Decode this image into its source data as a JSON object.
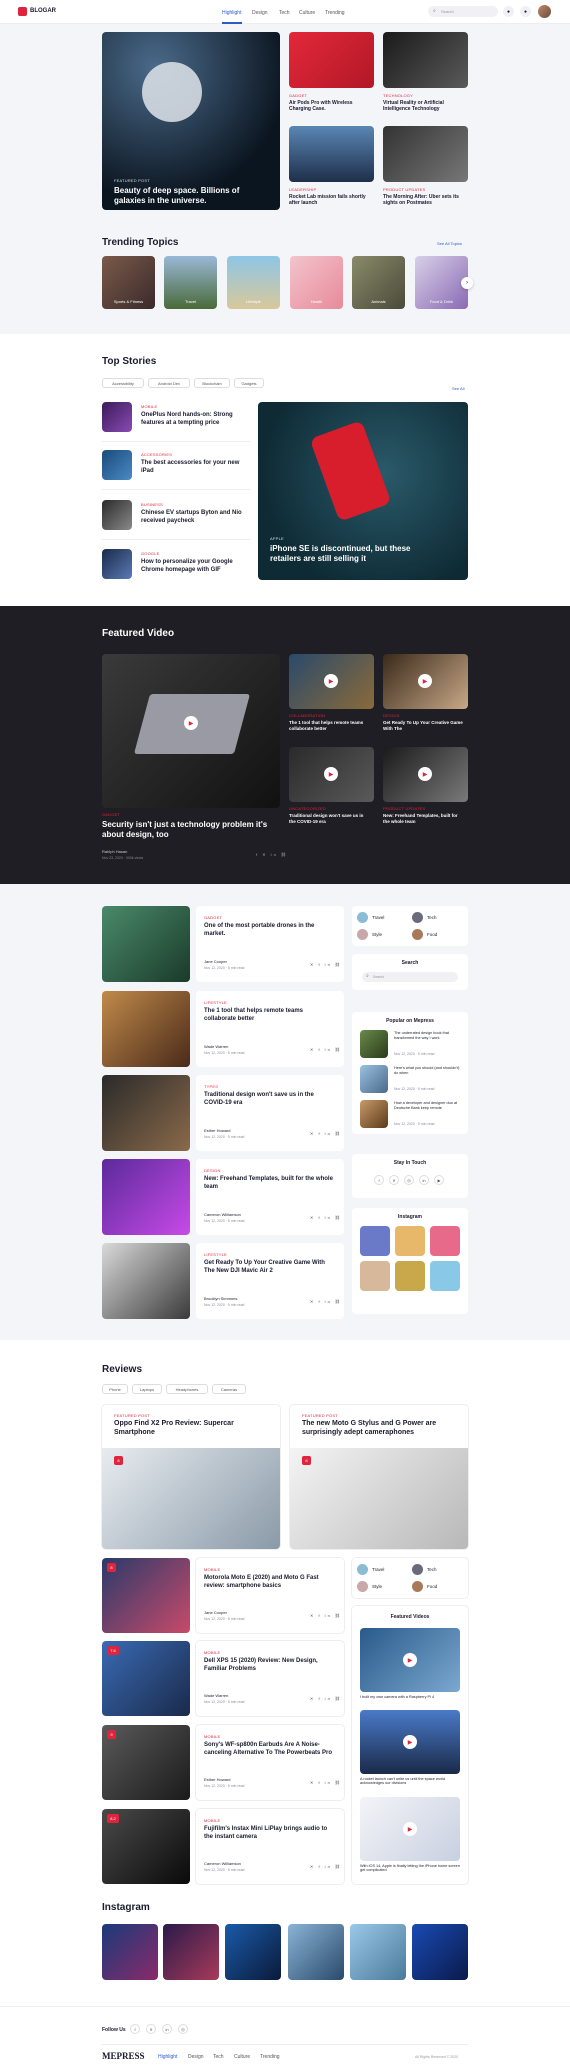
{
  "brand": {
    "name": "BLOGAR",
    "accent": "#e0243d"
  },
  "nav": [
    "Highlight",
    "Design",
    "Tech",
    "Culture",
    "Trending"
  ],
  "search": {
    "placeholder": "Search"
  },
  "hero": {
    "main": {
      "category": "FEATURED POST",
      "title": "Beauty of deep space. Billions of galaxies in the universe."
    },
    "items": [
      {
        "category": "GADGET",
        "title": "Air Pods Pro with Wireless Charging Case."
      },
      {
        "category": "TECHNOLOGY",
        "title": "Virtual Reality or Artificial Intelligence Technology"
      },
      {
        "category": "LEADERSHIP",
        "title": "Rocket Lab mission fails shortly after launch"
      },
      {
        "category": "PRODUCT UPDATES",
        "title": "The Morning After: Uber sets its sights on Postmates"
      }
    ]
  },
  "trending": {
    "title": "Trending Topics",
    "link": "See All Topics",
    "items": [
      "Sports & Fitness",
      "Travel",
      "Lifestyle",
      "Health",
      "Animals",
      "Food & Drink"
    ]
  },
  "top": {
    "title": "Top Stories",
    "link": "See All",
    "tabs": [
      "Accessibility",
      "Android Dev",
      "Blockchain",
      "Gadgets"
    ],
    "list": [
      {
        "category": "MOBILE",
        "title": "OnePlus Nord hands-on: Strong features at a tempting price"
      },
      {
        "category": "ACCESSORIES",
        "title": "The best accessories for your new iPad"
      },
      {
        "category": "BUSINESS",
        "title": "Chinese EV startups Byton and Nio received paycheck"
      },
      {
        "category": "GOOGLE",
        "title": "How to personalize your Google Chrome homepage with GIF"
      }
    ],
    "feature": {
      "category": "APPLE",
      "title": "iPhone SE is discontinued, but these retailers are still selling it"
    }
  },
  "video": {
    "title": "Featured Video",
    "main": {
      "category": "GADGET",
      "title": "Security isn't just a technology problem it's about design, too",
      "author": "Rahlph Hasan",
      "meta": "Nov 23, 2020  ·  300k views"
    },
    "items": [
      {
        "category": "COLLABORATION",
        "title": "The 1 tool that helps remote teams collaborate better"
      },
      {
        "category": "DESIGN",
        "title": "Get Ready To Up Your Creative Game With The"
      },
      {
        "category": "UNCATEGORIZED",
        "title": "Traditional design won't save us in the COVID-19 era"
      },
      {
        "category": "PRODUCT UPDATES",
        "title": "New: Freehand Templates, built for the whole team"
      }
    ]
  },
  "posts": [
    {
      "category": "GADGET",
      "title": "One of the most portable drones in the market.",
      "author": "Jane Cooper",
      "meta": "Nov 12, 2020  ·  5 min read"
    },
    {
      "category": "LIFESTYLE",
      "title": "The 1 tool that helps remote teams collaborate better",
      "author": "Wade Warren",
      "meta": "Nov 12, 2020  ·  5 min read"
    },
    {
      "category": "TYPES",
      "title": "Traditional design won't save us in the COVID-19 era",
      "author": "Esther Howard",
      "meta": "Nov 12, 2020  ·  5 min read"
    },
    {
      "category": "DESIGN",
      "title": "New: Freehand Templates, built for the whole team",
      "author": "Cameron Williamson",
      "meta": "Nov 12, 2020  ·  5 min read"
    },
    {
      "category": "LIFESTYLE",
      "title": "Get Ready To Up Your Creative Game With The New DJI Mavic Air 2",
      "author": "Brooklyn Simmons",
      "meta": "Nov 12, 2020  ·  5 min read"
    }
  ],
  "sidebar": {
    "cats": [
      "Travel",
      "Tech",
      "Style",
      "Food"
    ],
    "search_title": "Search",
    "search_placeholder": "Search",
    "popular_title": "Popular on Mepress",
    "popular": [
      {
        "title": "The underrated design book that transformed the way I work",
        "meta": "Nov 12, 2020  ·  5 min read"
      },
      {
        "title": "Here's what you should (and shouldn't) do when",
        "meta": "Nov 12, 2020  ·  5 min read"
      },
      {
        "title": "How a developer and designer duo at Deutsche Bank keep remote",
        "meta": "Nov 12, 2020  ·  5 min read"
      }
    ],
    "stay_title": "Stay In Touch",
    "instagram_title": "Instagram"
  },
  "reviews": {
    "title": "Reviews",
    "tabs": [
      "Phone",
      "Laptops",
      "Headphones",
      "Cameras"
    ],
    "top": [
      {
        "category": "FEATURED POST",
        "title": "Oppo Find X2 Pro Review: Supercar Smartphone",
        "score": "8"
      },
      {
        "category": "FEATURED POST",
        "title": "The new Moto G Stylus and G Power are surprisingly adept cameraphones",
        "score": "8"
      }
    ],
    "list": [
      {
        "category": "MOBILE",
        "title": "Motorola Moto E (2020) and Moto G Fast review: smartphone basics",
        "author": "Jane Cooper",
        "meta": "Nov 12, 2020  ·  5 min read",
        "score": "8"
      },
      {
        "category": "MOBILE",
        "title": "Dell XPS 15 (2020) Review: New Design, Familiar Problems",
        "author": "Wade Warren",
        "meta": "Nov 12, 2020  ·  5 min read",
        "score": "7.6"
      },
      {
        "category": "MOBILE",
        "title": "Sony's WF-sp800n Earbuds Are A Noise-canceling Alternative To The Powerbeats Pro",
        "author": "Esther Howard",
        "meta": "Nov 12, 2020  ·  5 min read",
        "score": "9"
      },
      {
        "category": "MOBILE",
        "title": "Fujifilm's Instax Mini LiPlay brings audio to the instant camera",
        "author": "Cameron Williamson",
        "meta": "Nov 12, 2020  ·  5 min read",
        "score": "8.2"
      }
    ],
    "videos_title": "Featured Videos",
    "videos": [
      {
        "title": "I built my own camera with a Raspberry Pi 4"
      },
      {
        "title": "A rocket launch can't unite us until the space world acknowledges our divisions"
      },
      {
        "title": "With iOS 14, Apple is finally letting the iPhone home screen get complicated"
      }
    ]
  },
  "instagram": {
    "title": "Instagram"
  },
  "footer": {
    "follow": "Follow Us",
    "logo": "MEPRESS",
    "links": [
      "Highlight",
      "Design",
      "Tech",
      "Culture",
      "Trending"
    ],
    "copyright": "All Rights Reserved © 2020"
  }
}
